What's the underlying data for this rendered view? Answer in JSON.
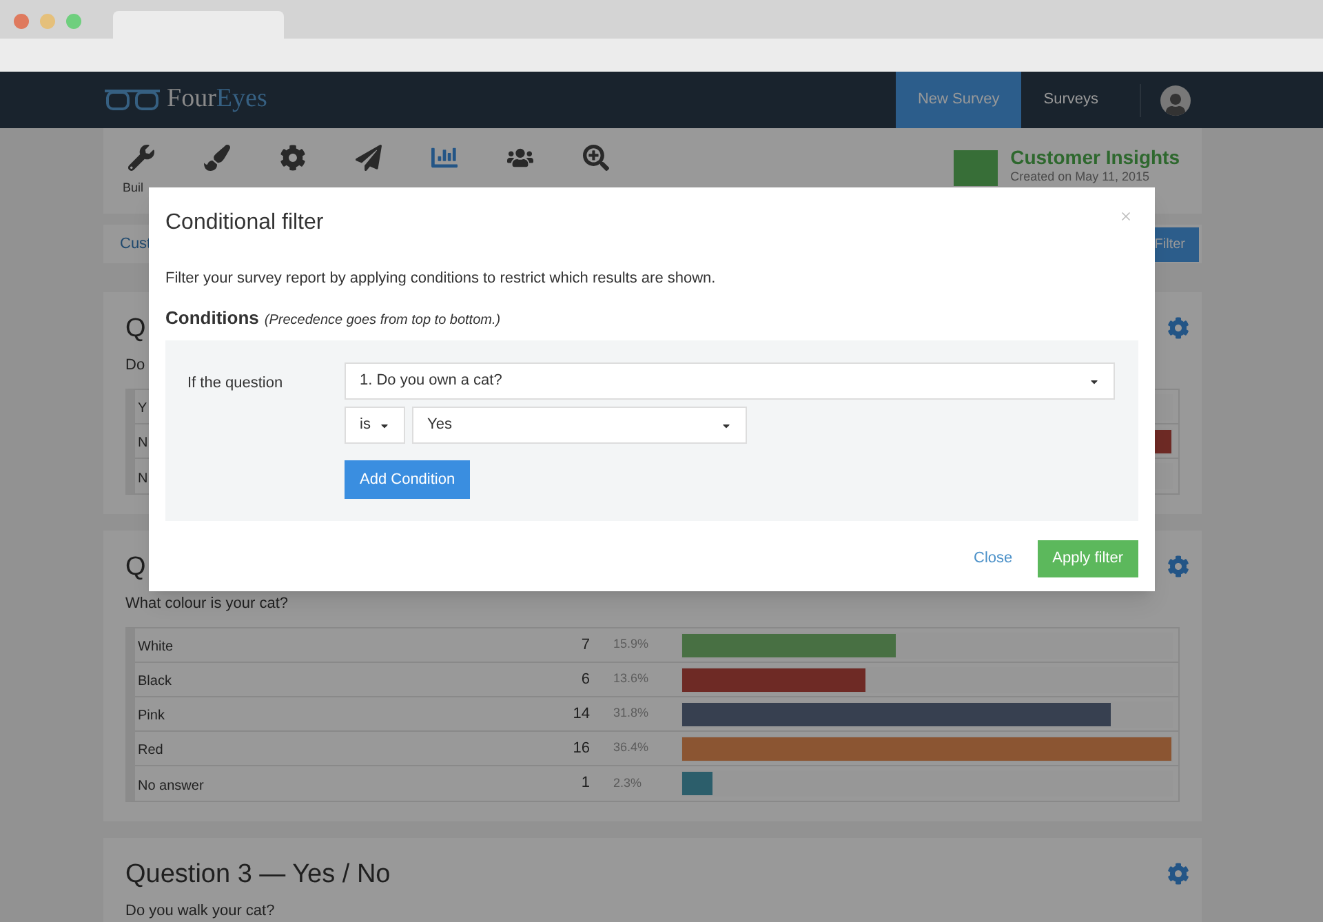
{
  "navbar": {
    "logo": {
      "part_1": "Four",
      "part_2": "Eyes"
    },
    "links": [
      {
        "label": "New Survey",
        "selected": true
      },
      {
        "label": "Surveys",
        "selected": false
      }
    ]
  },
  "toolbar": {
    "items": [
      {
        "label": "Buil",
        "selected": false
      },
      {
        "selected": false
      },
      {
        "selected": false
      },
      {
        "selected": false
      },
      {
        "selected": true
      },
      {
        "selected": false
      },
      {
        "selected": false
      }
    ]
  },
  "survey": {
    "title": "Customer Insights",
    "created": "Created on May 11, 2015"
  },
  "filter_bar": {
    "link": "Cust",
    "button": "Filter"
  },
  "questions": [
    {
      "title": "Q",
      "text": "Do",
      "rows": [
        {
          "label": "Y"
        },
        {
          "label": "N",
          "level": 1,
          "color": "#6e2a25"
        },
        {
          "label": "N"
        }
      ]
    },
    {
      "title": "Q",
      "text": "What colour is your cat?",
      "rows": [
        {
          "label": "White",
          "count": "7",
          "percent": "15.9%",
          "level": 0.4375,
          "color": "#487043"
        },
        {
          "label": "Black",
          "count": "6",
          "percent": "13.6%",
          "level": 0.375,
          "color": "#6e2a25"
        },
        {
          "label": "Pink",
          "count": "14",
          "percent": "31.8%",
          "level": 0.875,
          "color": "#374050"
        },
        {
          "label": "Red",
          "count": "16",
          "percent": "36.4%",
          "level": 1,
          "color": "#8b5532"
        },
        {
          "label": "No answer",
          "count": "1",
          "percent": "2.3%",
          "level": 0.0625,
          "color": "#2c5e6b"
        }
      ]
    },
    {
      "title": "Question 3 — Yes / No",
      "text": "Do you walk your cat?"
    }
  ],
  "modal": {
    "title": "Conditional filter",
    "description": "Filter your survey report by applying conditions to restrict which results are shown.",
    "conditions_heading": "Conditions",
    "conditions_note": "(Precedence goes from top to bottom.)",
    "condition": {
      "label": "If the question",
      "question": "1. Do you own a cat?",
      "operator": "is",
      "value": "Yes"
    },
    "add_button": "Add Condition",
    "close_button": "Close",
    "apply_button": "Apply filter"
  }
}
